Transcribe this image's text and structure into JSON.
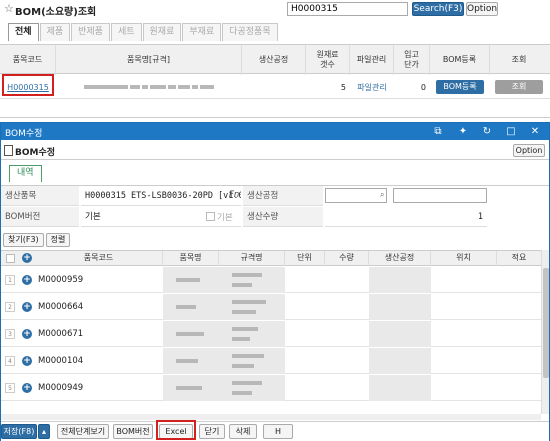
{
  "top": {
    "title": "BOM(소요량)조회",
    "search_value": "H0000315",
    "search_btn": "Search(F3)",
    "option_btn": "Option",
    "tabs": [
      "전체",
      "제품",
      "반제품",
      "세트",
      "원재료",
      "부재료",
      "다공정품목"
    ],
    "headers": [
      "품목코드",
      "품목명[규격]",
      "생산공정",
      "원재료 갯수",
      "파일관리",
      "입고단가",
      "BOM등록",
      "조회"
    ],
    "row": {
      "code": "H0000315",
      "count": "5",
      "file": "파일관리",
      "price": "0",
      "bom_btn": "BOM등록",
      "view_btn": "조회"
    }
  },
  "modal": {
    "bar_title": "BOM수정",
    "title": "BOM수정",
    "option_btn": "Option",
    "tab": "내역",
    "form": {
      "item_label": "생산품목",
      "item_value": "H0000315 ETS-LSB0036-20PD [v1.0.",
      "item_suffix": "Fn",
      "process_label": "생산공정",
      "bom_label": "BOM버전",
      "bom_value": "기본",
      "bom_chk_label": "기본",
      "qty_label": "생산수량",
      "qty_value": "1"
    },
    "find_btn": "찾기(F3)",
    "sort_btn": "정렬",
    "grid_headers": [
      "품목코드",
      "품목명",
      "규격명",
      "단위",
      "수량",
      "생산공정",
      "위치",
      "적요"
    ],
    "rows": [
      {
        "num": "1",
        "code": "M0000959"
      },
      {
        "num": "2",
        "code": "M0000664"
      },
      {
        "num": "3",
        "code": "M0000671"
      },
      {
        "num": "4",
        "code": "M0000104"
      },
      {
        "num": "5",
        "code": "M0000949"
      }
    ],
    "bottom": {
      "save": "저장(F8)",
      "view_all": "전체단계보기",
      "bom_ver": "BOM버전",
      "excel": "Excel",
      "close": "닫기",
      "delete": "삭제",
      "h": "H"
    }
  }
}
